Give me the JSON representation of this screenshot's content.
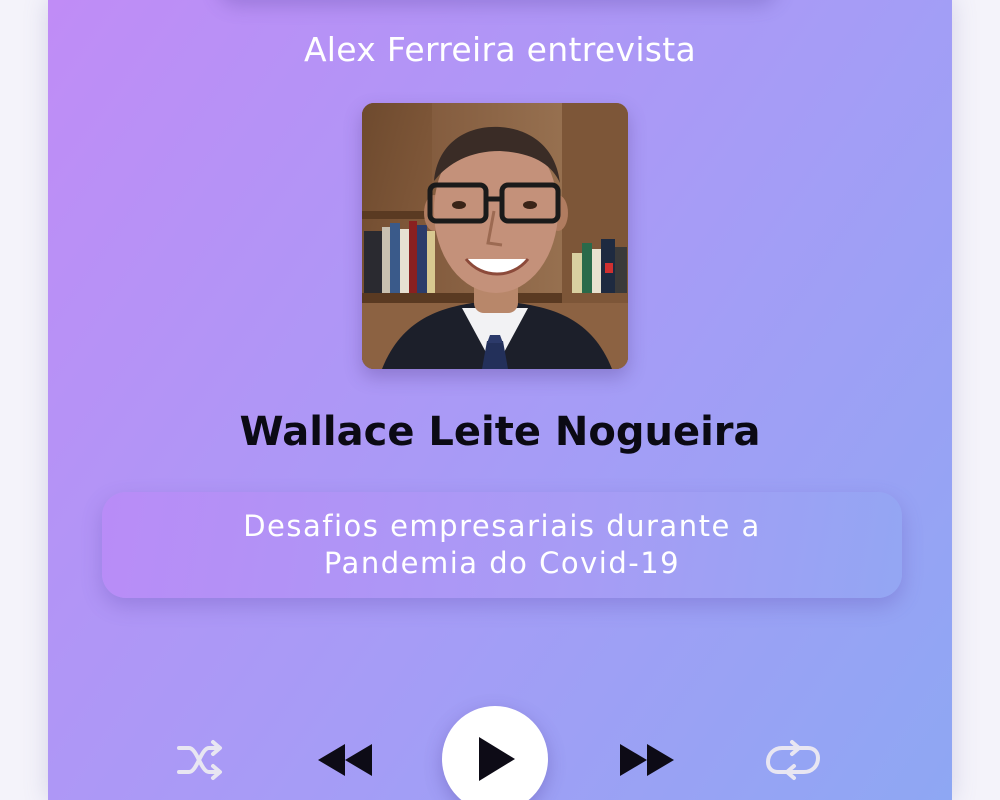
{
  "player": {
    "interviewer_line": "Alex Ferreira entrevista",
    "guest_name": "Wallace Leite Nogueira",
    "topic_lines": [
      "Desafios empresariais durante a",
      "Pandemia do Covid-19"
    ],
    "controls": {
      "shuffle_icon": "shuffle-icon",
      "previous_icon": "rewind-icon",
      "play_icon": "play-icon",
      "next_icon": "fast-forward-icon",
      "repeat_icon": "repeat-icon"
    }
  }
}
